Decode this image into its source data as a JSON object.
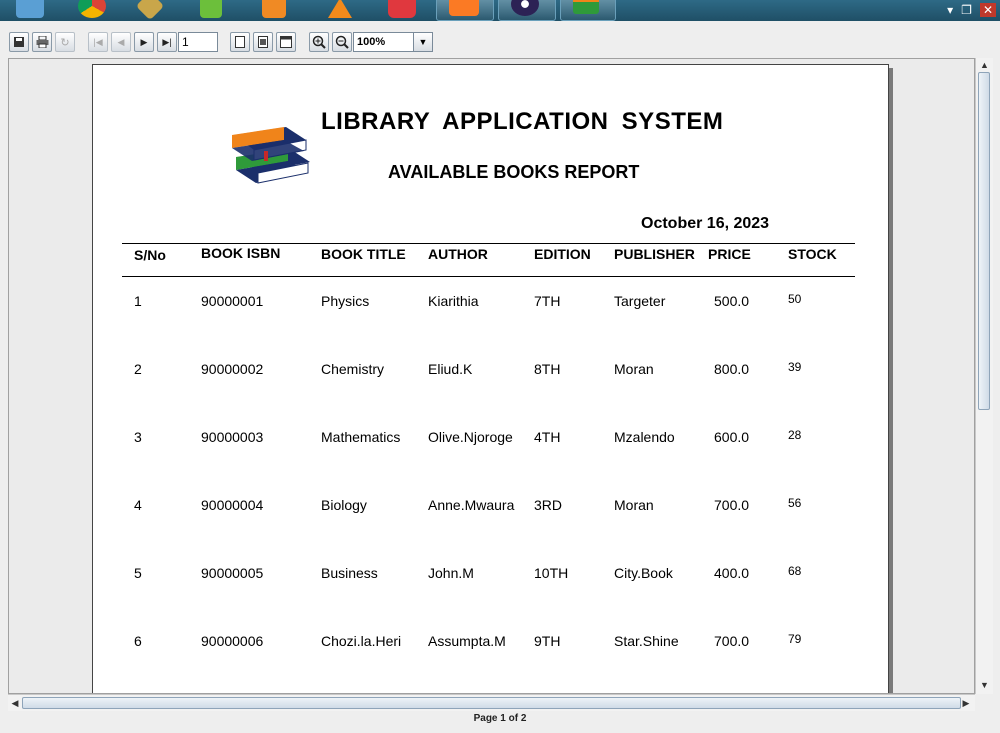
{
  "taskbar": {
    "icons": [
      "file-manager-icon",
      "chrome-icon",
      "tools-icon",
      "editor-icon",
      "media-player-icon",
      "vlc-icon",
      "vivaldi-icon",
      "xampp-icon",
      "eclipse-icon",
      "library-app-icon"
    ]
  },
  "toolbar": {
    "page_number": "1",
    "zoom": "100%"
  },
  "report": {
    "title": "LIBRARY APPLICATION SYSTEM",
    "subtitle": "AVAILABLE BOOKS REPORT",
    "date": "October 16, 2023",
    "headers": {
      "sno": "S/No",
      "isbn": "BOOK ISBN",
      "title": "BOOK TITLE",
      "author": "AUTHOR",
      "edition": "EDITION",
      "publisher": "PUBLISHER",
      "price": "PRICE",
      "stock": "STOCK"
    },
    "rows": [
      {
        "sno": "1",
        "isbn": "90000001",
        "title": "Physics",
        "author": "Kiarithia",
        "edition": "7TH",
        "publisher": "Targeter",
        "price": "500.0",
        "stock": "50"
      },
      {
        "sno": "2",
        "isbn": "90000002",
        "title": "Chemistry",
        "author": "Eliud.K",
        "edition": "8TH",
        "publisher": "Moran",
        "price": "800.0",
        "stock": "39"
      },
      {
        "sno": "3",
        "isbn": "90000003",
        "title": "Mathematics",
        "author": "Olive.Njoroge",
        "edition": "4TH",
        "publisher": "Mzalendo",
        "price": "600.0",
        "stock": "28"
      },
      {
        "sno": "4",
        "isbn": "90000004",
        "title": "Biology",
        "author": "Anne.Mwaura",
        "edition": "3RD",
        "publisher": "Moran",
        "price": "700.0",
        "stock": "56"
      },
      {
        "sno": "5",
        "isbn": "90000005",
        "title": "Business",
        "author": "John.M",
        "edition": "10TH",
        "publisher": "City.Book",
        "price": "400.0",
        "stock": "68"
      },
      {
        "sno": "6",
        "isbn": "90000006",
        "title": "Chozi.la.Heri",
        "author": "Assumpta.M",
        "edition": "9TH",
        "publisher": "Star.Shine",
        "price": "700.0",
        "stock": "79"
      }
    ]
  },
  "status": {
    "page_info": "Page 1 of 2"
  },
  "colors": {
    "taskbar": "#1f4f66",
    "book_orange": "#f0841a",
    "book_green": "#2f9a3a",
    "book_navy": "#1b2f6b"
  }
}
